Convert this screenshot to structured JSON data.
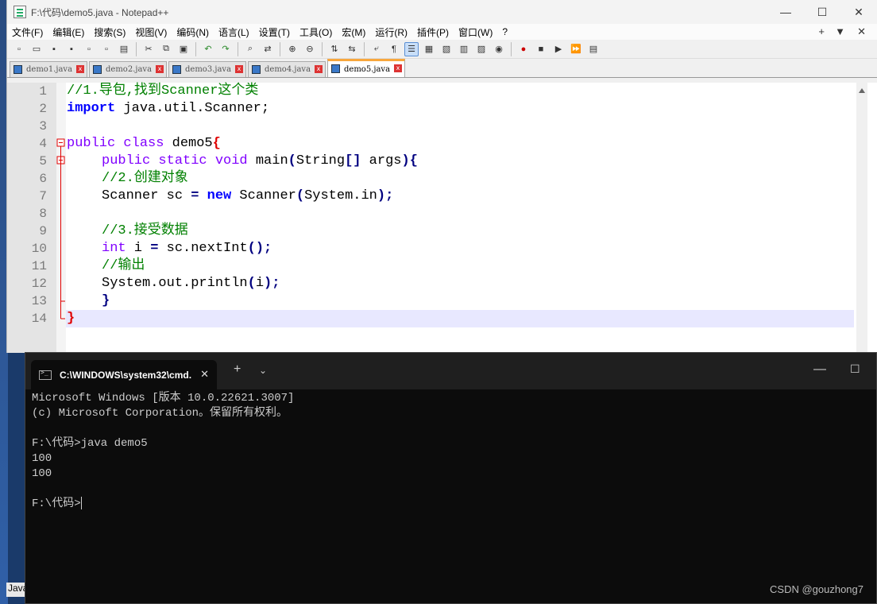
{
  "notepad": {
    "title": "F:\\代码\\demo5.java - Notepad++",
    "menu": [
      "文件(F)",
      "编辑(E)",
      "搜索(S)",
      "视图(V)",
      "编码(N)",
      "语言(L)",
      "设置(T)",
      "工具(O)",
      "宏(M)",
      "运行(R)",
      "插件(P)",
      "窗口(W)",
      "?"
    ],
    "menu_right": [
      "+",
      "▼",
      "✕"
    ],
    "tabs": [
      "demo1.java",
      "demo2.java",
      "demo3.java",
      "demo4.java",
      "demo5.java"
    ],
    "active_tab": "demo5.java",
    "line_numbers": [
      "1",
      "2",
      "3",
      "4",
      "5",
      "6",
      "7",
      "8",
      "9",
      "10",
      "11",
      "12",
      "13",
      "14"
    ],
    "code": {
      "l1": "//1.导包,找到Scanner这个类",
      "l2_kw": "import",
      "l2_rest": " java.util.Scanner;",
      "l4_a": "public class",
      "l4_b": " demo5",
      "l4_c": "{",
      "l5_a": "public static void",
      "l5_b": " main",
      "l5_c": "(",
      "l5_d": "String",
      "l5_e": "[]",
      "l5_f": " args",
      "l5_g": "){",
      "l6": "//2.创建对象",
      "l7_a": "Scanner sc ",
      "l7_b": "=",
      "l7_c": " new",
      "l7_d": " Scanner",
      "l7_e": "(",
      "l7_f": "System.in",
      "l7_g": ");",
      "l9": "//3.接受数据",
      "l10_a": "int",
      "l10_b": " i ",
      "l10_c": "=",
      "l10_d": " sc.nextInt",
      "l10_e": "();",
      "l11": "//输出",
      "l12_a": "System.out.println",
      "l12_b": "(",
      "l12_c": "i",
      "l12_d": ");",
      "l13": "}",
      "l14": "}"
    }
  },
  "cmd": {
    "tab_title": "C:\\WINDOWS\\system32\\cmd.",
    "lines": [
      "Microsoft Windows [版本 10.0.22621.3007]",
      "(c) Microsoft Corporation。保留所有权利。",
      "",
      "F:\\代码>java demo5",
      "100",
      "100",
      "",
      "F:\\代码>"
    ]
  },
  "desktop": {
    "taskbar_label": "Java"
  },
  "watermark": "CSDN @gouzhong7"
}
